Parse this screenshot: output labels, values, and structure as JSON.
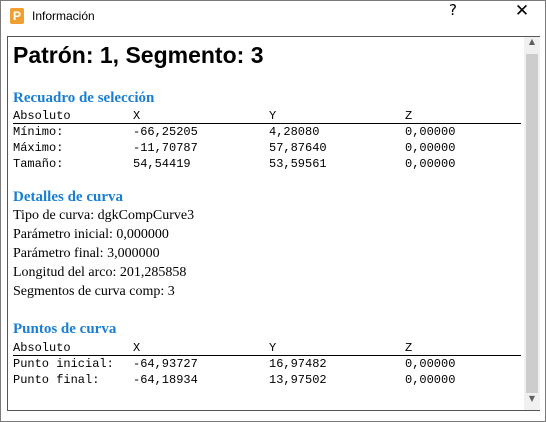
{
  "window": {
    "title": "Información",
    "app_icon_letter": "P",
    "help_label": "?",
    "close_label": "✕"
  },
  "header": {
    "title": "Patrón: 1, Segmento: 3"
  },
  "bbox_section": {
    "heading": "Recuadro de selección",
    "columns": [
      "Absoluto",
      "X",
      "Y",
      "Z"
    ],
    "rows": [
      {
        "label": "Mínimo:",
        "x": "-66,25205",
        "y": "4,28080",
        "z": "0,00000"
      },
      {
        "label": "Máximo:",
        "x": "-11,70787",
        "y": "57,87640",
        "z": "0,00000"
      },
      {
        "label": "Tamaño:",
        "x": "54,54419",
        "y": "53,59561",
        "z": "0,00000"
      }
    ]
  },
  "curve_details": {
    "heading": "Detalles de curva",
    "lines": [
      "Tipo de curva: dgkCompCurve3",
      "Parámetro inicial: 0,000000",
      "Parámetro final: 3,000000",
      "Longitud del arco: 201,285858",
      "Segmentos de curva comp: 3"
    ]
  },
  "curve_points": {
    "heading": "Puntos de curva",
    "columns": [
      "Absoluto",
      "X",
      "Y",
      "Z"
    ],
    "rows": [
      {
        "label": "Punto inicial:",
        "x": "-64,93727",
        "y": "16,97482",
        "z": "0,00000"
      },
      {
        "label": "Punto final:",
        "x": "-64,18934",
        "y": "13,97502",
        "z": "0,00000"
      }
    ]
  },
  "scrollbar": {
    "up_arrow": "▲",
    "down_arrow": "▼"
  }
}
